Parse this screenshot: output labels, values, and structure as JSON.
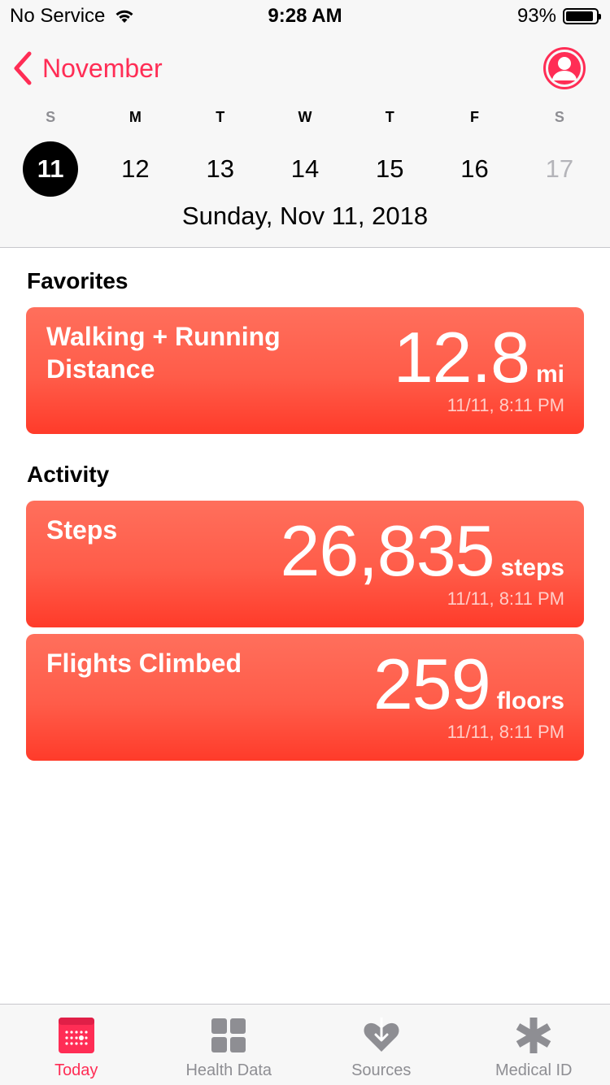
{
  "status_bar": {
    "carrier": "No Service",
    "time": "9:28 AM",
    "battery": "93%",
    "battery_level": 0.93
  },
  "header": {
    "back_label": "November",
    "weekdays": [
      "S",
      "M",
      "T",
      "W",
      "T",
      "F",
      "S"
    ],
    "dates": [
      "11",
      "12",
      "13",
      "14",
      "15",
      "16",
      "17"
    ],
    "selected_index": 0,
    "full_date": "Sunday, Nov 11, 2018"
  },
  "favorites": {
    "section_title": "Favorites",
    "cards": [
      {
        "title": "Walking + Running Distance",
        "value": "12.8",
        "unit": "mi",
        "timestamp": "11/11, 8:11 PM"
      }
    ]
  },
  "activity": {
    "section_title": "Activity",
    "cards": [
      {
        "title": "Steps",
        "value": "26,835",
        "unit": "steps",
        "timestamp": "11/11, 8:11 PM"
      },
      {
        "title": "Flights Climbed",
        "value": "259",
        "unit": "floors",
        "timestamp": "11/11, 8:11 PM"
      }
    ]
  },
  "tab_bar": {
    "tabs": [
      {
        "label": "Today",
        "icon": "calendar-icon",
        "active": true
      },
      {
        "label": "Health Data",
        "icon": "grid-icon",
        "active": false
      },
      {
        "label": "Sources",
        "icon": "heart-download-icon",
        "active": false
      },
      {
        "label": "Medical ID",
        "icon": "asterisk-icon",
        "active": false
      }
    ]
  },
  "colors": {
    "accent": "#ff2d55",
    "card_top": "#ff6f5c",
    "card_bottom": "#ff3b2a",
    "inactive": "#8e8e93"
  }
}
